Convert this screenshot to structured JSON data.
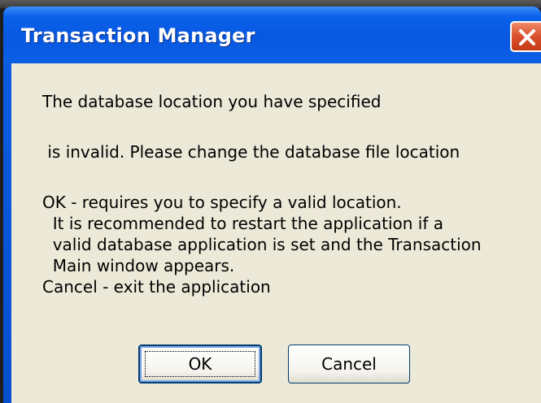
{
  "window": {
    "title": "Transaction Manager"
  },
  "message": {
    "line1": "The database location you have specified",
    "line2": " is invalid. Please change the database file location",
    "line3": "OK - requires you to specify a valid location.",
    "line4": "  It is recommended to restart the application if a",
    "line5": "  valid database application is set and the Transaction",
    "line6": "  Main window appears.",
    "line7": "Cancel - exit the application"
  },
  "buttons": {
    "ok_label": "OK",
    "cancel_label": "Cancel"
  },
  "icons": {
    "close": "close-icon"
  },
  "colors": {
    "titlebar": "#0a5de5",
    "client_bg": "#ece9d8",
    "close_button": "#d9512c"
  }
}
